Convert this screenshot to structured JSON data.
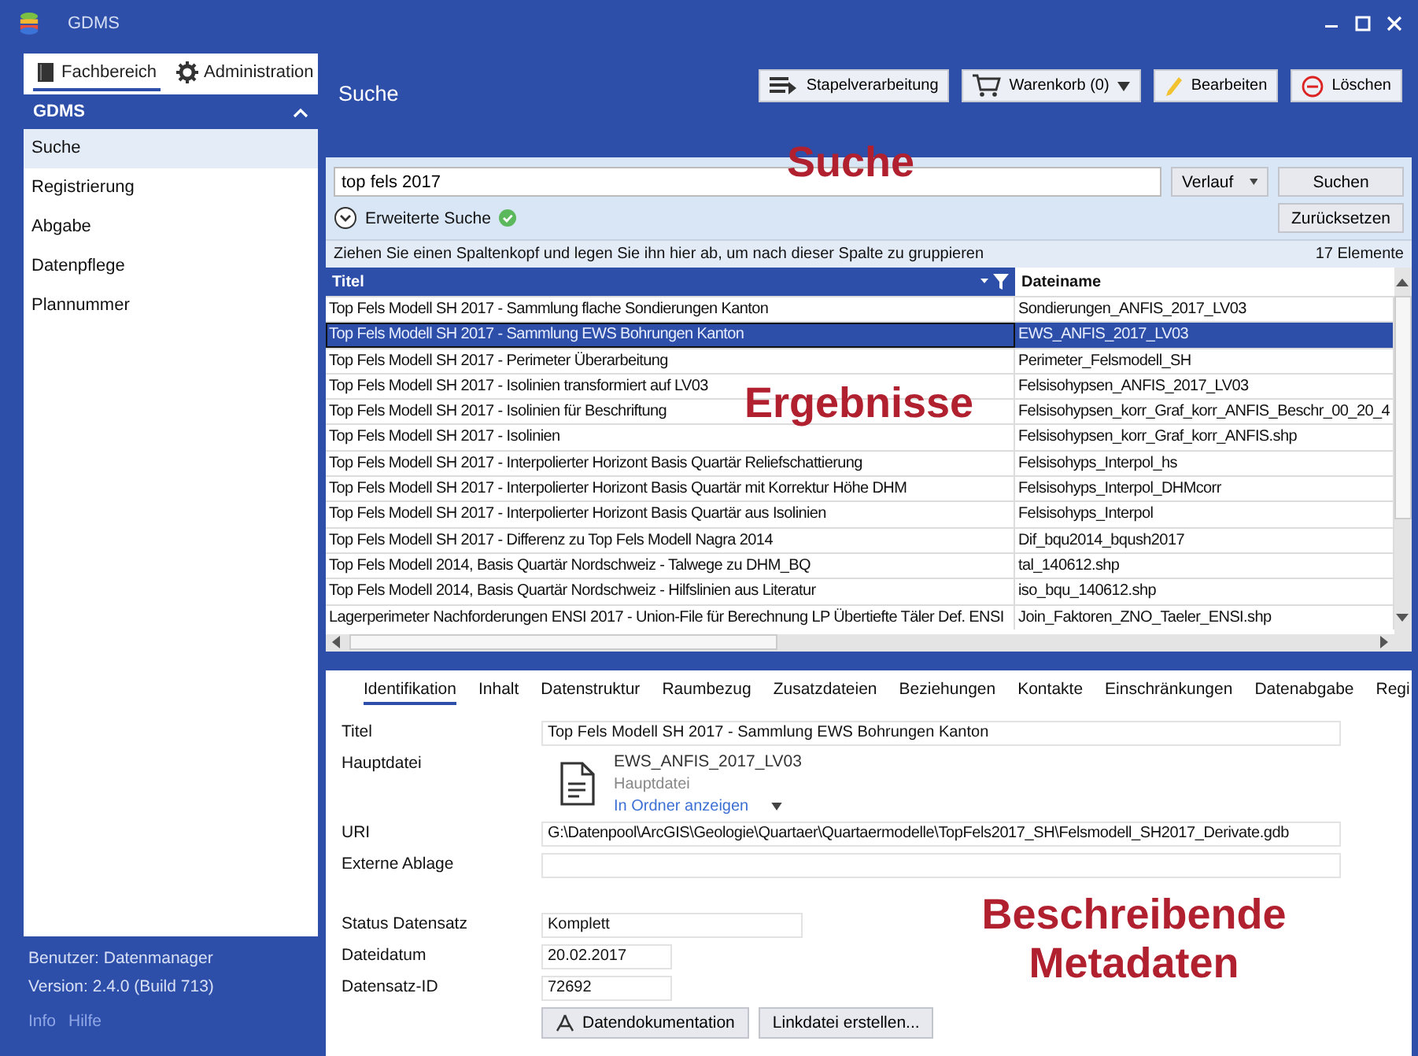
{
  "window": {
    "title": "GDMS"
  },
  "sidebar": {
    "tabs": [
      {
        "label": "Fachbereich",
        "selected": true
      },
      {
        "label": "Administration",
        "selected": false
      }
    ],
    "section": {
      "title": "GDMS",
      "expanded": true
    },
    "items": [
      {
        "label": "Suche",
        "selected": true
      },
      {
        "label": "Registrierung",
        "selected": false
      },
      {
        "label": "Abgabe",
        "selected": false
      },
      {
        "label": "Datenpflege",
        "selected": false
      },
      {
        "label": "Plannummer",
        "selected": false
      }
    ],
    "footer": {
      "user": "Benutzer:  Datenmanager",
      "version": "Version:  2.4.0 (Build 713)",
      "links": [
        "Info",
        "Hilfe"
      ]
    }
  },
  "page": {
    "title": "Suche"
  },
  "toolbar": [
    {
      "label": "Stapelverarbeitung",
      "dropdown": false
    },
    {
      "label": "Warenkorb (0)",
      "dropdown": true
    },
    {
      "label": "Bearbeiten",
      "dropdown": false
    },
    {
      "label": "Löschen",
      "dropdown": false
    }
  ],
  "search": {
    "value": "top fels 2017",
    "history_button": "Verlauf",
    "search_button": "Suchen",
    "reset_button": "Zurücksetzen",
    "advanced": {
      "label": "Erweiterte Suche",
      "active": true
    }
  },
  "grouping_hint": "Ziehen Sie einen Spaltenkopf und legen Sie ihn hier ab, um nach dieser Spalte zu gruppieren",
  "count": "17 Elemente",
  "table": {
    "columns": [
      "Titel",
      "Dateiname"
    ],
    "rows": [
      {
        "cells": [
          "Top Fels Modell SH 2017 - Sammlung flache Sondierungen Kanton",
          "Sondierungen_ANFIS_2017_LV03"
        ],
        "selected": false
      },
      {
        "cells": [
          "Top Fels Modell SH 2017 - Sammlung EWS Bohrungen Kanton",
          "EWS_ANFIS_2017_LV03"
        ],
        "selected": true
      },
      {
        "cells": [
          "Top Fels Modell SH 2017 - Perimeter Überarbeitung",
          "Perimeter_Felsmodell_SH"
        ],
        "selected": false
      },
      {
        "cells": [
          "Top Fels Modell SH 2017 - Isolinien transformiert auf LV03",
          "Felsisohypsen_ANFIS_2017_LV03"
        ],
        "selected": false
      },
      {
        "cells": [
          "Top Fels Modell SH 2017 - Isolinien für Beschriftung",
          "Felsisohypsen_korr_Graf_korr_ANFIS_Beschr_00_20_4"
        ],
        "selected": false
      },
      {
        "cells": [
          "Top Fels Modell SH 2017 - Isolinien",
          "Felsisohypsen_korr_Graf_korr_ANFIS.shp"
        ],
        "selected": false
      },
      {
        "cells": [
          "Top Fels Modell SH 2017 - Interpolierter Horizont Basis Quartär Reliefschattierung",
          "Felsisohyps_Interpol_hs"
        ],
        "selected": false
      },
      {
        "cells": [
          "Top Fels Modell SH 2017 - Interpolierter Horizont Basis Quartär mit Korrektur Höhe DHM",
          "Felsisohyps_Interpol_DHMcorr"
        ],
        "selected": false
      },
      {
        "cells": [
          "Top Fels Modell SH 2017 - Interpolierter Horizont Basis Quartär aus Isolinien",
          "Felsisohyps_Interpol"
        ],
        "selected": false
      },
      {
        "cells": [
          "Top Fels Modell SH 2017 - Differenz zu Top Fels Modell Nagra 2014",
          "Dif_bqu2014_bqush2017"
        ],
        "selected": false
      },
      {
        "cells": [
          "Top Fels Modell 2014, Basis Quartär Nordschweiz - Talwege zu DHM_BQ",
          "tal_140612.shp"
        ],
        "selected": false
      },
      {
        "cells": [
          "Top Fels Modell 2014, Basis Quartär Nordschweiz - Hilfslinien aus Literatur",
          "iso_bqu_140612.shp"
        ],
        "selected": false
      },
      {
        "cells": [
          "Lagerperimeter Nachforderungen ENSI 2017 - Union-File für Berechnung LP Übertiefte Täler Def. ENSI",
          "Join_Faktoren_ZNO_Taeler_ENSI.shp"
        ],
        "selected": false
      }
    ]
  },
  "detail": {
    "tabs": [
      {
        "label": "Identifikation",
        "selected": true
      },
      {
        "label": "Inhalt",
        "selected": false
      },
      {
        "label": "Datenstruktur",
        "selected": false
      },
      {
        "label": "Raumbezug",
        "selected": false
      },
      {
        "label": "Zusatzdateien",
        "selected": false
      },
      {
        "label": "Beziehungen",
        "selected": false
      },
      {
        "label": "Kontakte",
        "selected": false
      },
      {
        "label": "Einschränkungen",
        "selected": false
      },
      {
        "label": "Datenabgabe",
        "selected": false
      },
      {
        "label": "Regi",
        "selected": false
      }
    ],
    "title_label": "Titel",
    "title_value": "Top Fels Modell SH 2017 - Sammlung EWS Bohrungen Kanton",
    "file_label": "Hauptdatei",
    "file_name": "EWS_ANFIS_2017_LV03",
    "file_caption": "Hauptdatei",
    "file_link": "In Ordner anzeigen",
    "uri_label": "URI",
    "uri_value": "G:\\Datenpool\\ArcGIS\\Geologie\\Quartaer\\Quartaermodelle\\TopFels2017_SH\\Felsmodell_SH2017_Derivate.gdb",
    "external_label": "Externe Ablage",
    "status_label": "Status Datensatz",
    "status_value": "Komplett",
    "date_label": "Dateidatum",
    "date_value": "20.02.2017",
    "id_label": "Datensatz-ID",
    "id_value": "72692",
    "buttons": [
      "Datendokumentation",
      "Linkdatei erstellen..."
    ]
  },
  "annotations": [
    "Suche",
    "Ergebnisse",
    "Beschreibende Metadaten"
  ]
}
